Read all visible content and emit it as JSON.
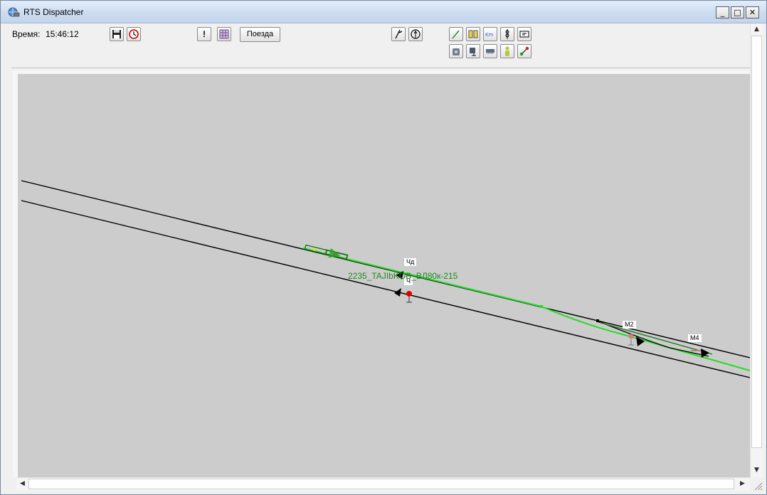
{
  "window": {
    "title": "RTS Dispatcher"
  },
  "window_controls": {
    "minimize": "_",
    "maximize": "□",
    "close": "✕"
  },
  "toolbar": {
    "time_label": "Время:",
    "time_value": "15:46:12",
    "trains_button": "Поезда",
    "alert_button": "!"
  },
  "map": {
    "train_label": "2235_TAJIbKOB_BЛ80к-215",
    "signals": [
      {
        "label": "Чд"
      },
      {
        "label": "Ч"
      },
      {
        "label": "М2"
      },
      {
        "label": "М4"
      }
    ]
  },
  "scrollbars": {
    "up": "▲",
    "down": "▼",
    "left": "◀",
    "right": "▶"
  },
  "colors": {
    "canvas_background": "#cccccc",
    "active_route": "#22dd22",
    "track": "#000000",
    "train": "#1f8a1f",
    "signal_red": "#e00000",
    "titlebar": "#cddcf0"
  }
}
